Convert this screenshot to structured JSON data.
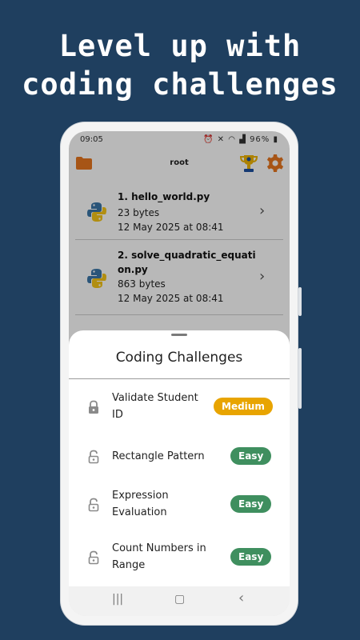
{
  "promo": {
    "headline_line1": "Level up with",
    "headline_line2": "coding challenges"
  },
  "status_bar": {
    "time": "09:05",
    "icons": [
      "alarm-icon",
      "mute-icon",
      "wifi-icon",
      "signal-icon"
    ],
    "battery": "96%"
  },
  "app_bar": {
    "title": "root",
    "left_icon": "folder-icon",
    "right_icons": [
      "trophy-icon",
      "gear-icon"
    ]
  },
  "files": [
    {
      "name": "1. hello_world.py",
      "size": "23 bytes",
      "date": "12 May 2025 at 08:41"
    },
    {
      "name_line1": "2. solve_quadratic_equati",
      "name_line2": "on.py",
      "size": "863 bytes",
      "date": "12 May 2025 at 08:41"
    }
  ],
  "sheet": {
    "title": "Coding Challenges",
    "items": [
      {
        "label_line1": "Validate Student",
        "label_line2": "ID",
        "difficulty": "Medium",
        "locked": true
      },
      {
        "label_line1": "Rectangle Pattern",
        "label_line2": "",
        "difficulty": "Easy",
        "locked": false
      },
      {
        "label_line1": "Expression",
        "label_line2": "Evaluation",
        "difficulty": "Easy",
        "locked": false
      },
      {
        "label_line1": "Count Numbers in",
        "label_line2": "Range",
        "difficulty": "Easy",
        "locked": false
      }
    ]
  },
  "nav_bar": {
    "recents": "|||",
    "home": "▢",
    "back": "‹"
  },
  "colors": {
    "background": "#1f3f5f",
    "accent_orange": "#e8761f",
    "medium_badge": "#e8a400",
    "easy_badge": "#3f8f5f"
  }
}
